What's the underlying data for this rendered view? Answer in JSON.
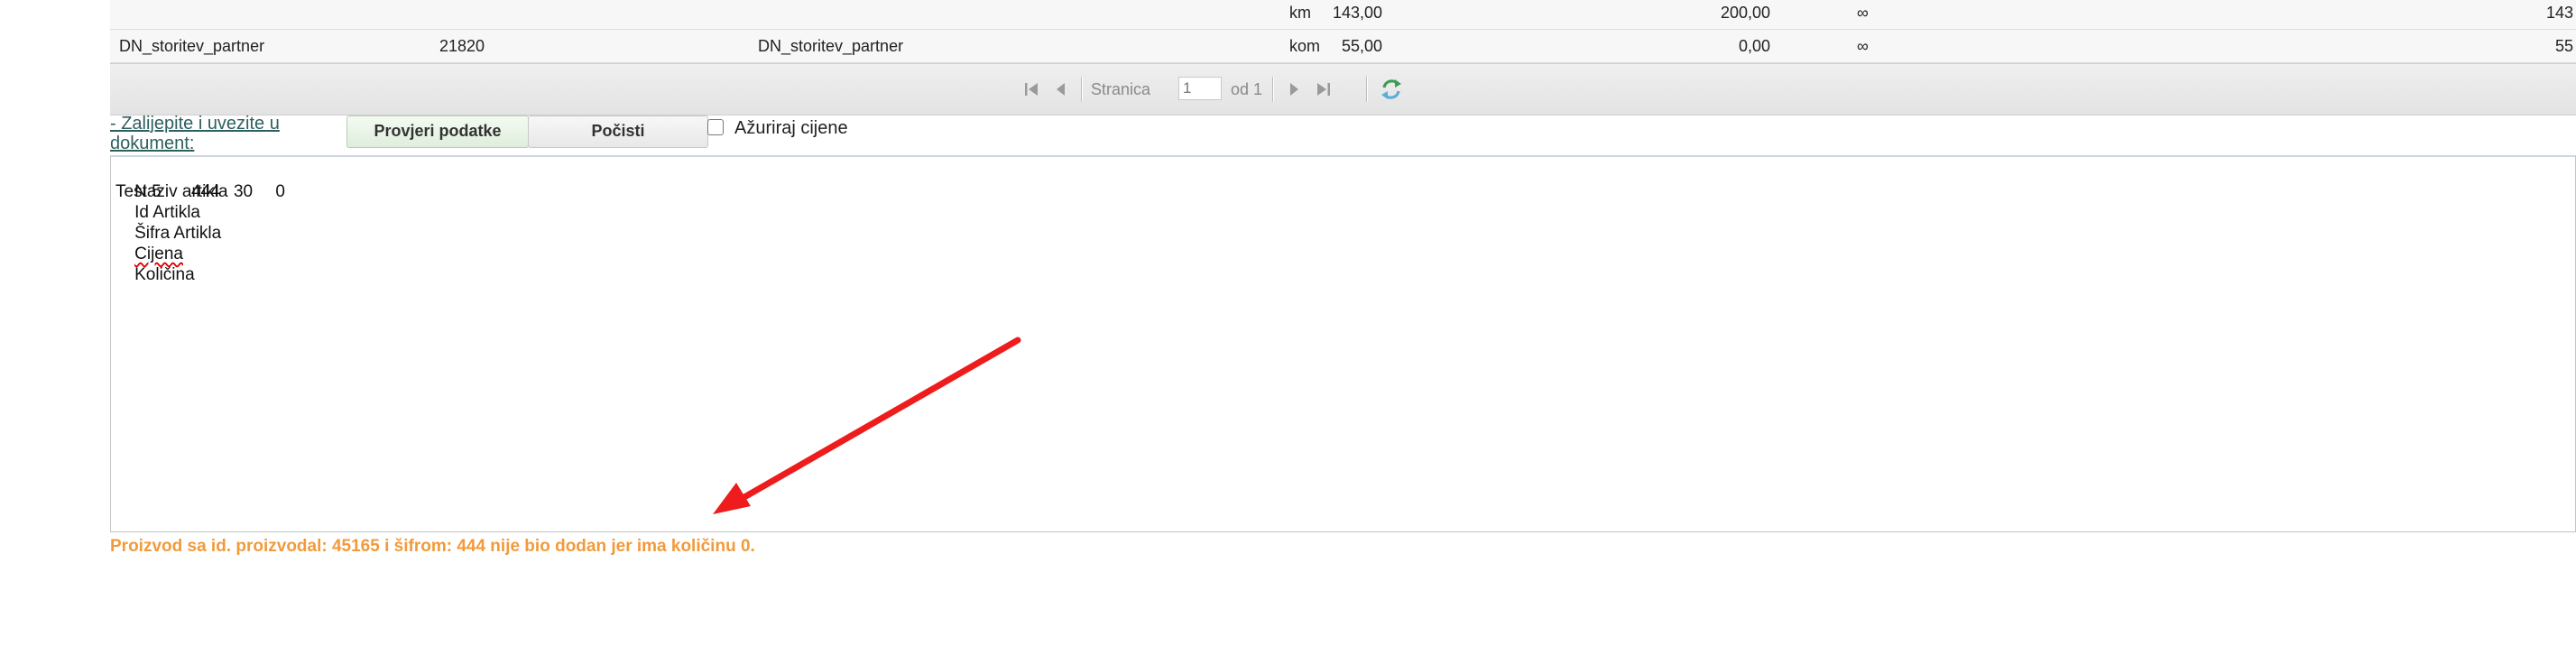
{
  "grid": {
    "rows": [
      {
        "name": "",
        "id": "",
        "name2": "",
        "price": "143,00",
        "unit": "km",
        "value": "200,00",
        "inf": "∞",
        "last": "143"
      },
      {
        "name": "DN_storitev_partner",
        "id": "21820",
        "name2": "DN_storitev_partner",
        "price": "55,00",
        "unit": "kom",
        "value": "0,00",
        "inf": "∞",
        "last": "55"
      }
    ]
  },
  "pager": {
    "page_label": "Stranica",
    "page_value": "1",
    "of_label": "od 1",
    "icons": {
      "first": "first-page-icon",
      "prev": "prev-page-icon",
      "next": "next-page-icon",
      "last": "last-page-icon",
      "refresh": "refresh-icon"
    }
  },
  "toolbar": {
    "paste_link": "- Zalijepite i uvezite u dokument:",
    "check_button": "Provjeri podatke",
    "reset_button": "Počisti",
    "update_prices_label": "Ažuriraj cijene",
    "update_prices_checked": false
  },
  "textarea": {
    "headers": [
      "Naziv artikla",
      "Id Artikla",
      "Šifra Artikla",
      "Cijena",
      "Količina"
    ],
    "row": [
      "Test 5",
      "444",
      "30",
      "0"
    ]
  },
  "message": {
    "text": "Proizvod sa id. proizvodal: 45165 i šifrom: 444 nije bio dodan jer ima količinu 0.",
    "color": "#f29a3a"
  },
  "annotation": {
    "arrow_color": "#ee1c1c"
  }
}
